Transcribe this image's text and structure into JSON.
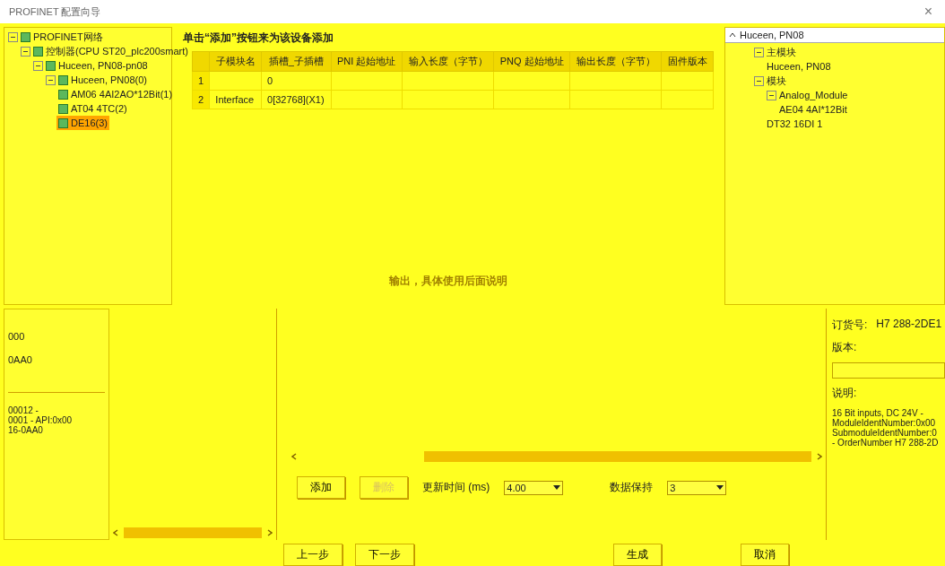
{
  "window": {
    "title": "PROFINET 配置向导",
    "close": "×"
  },
  "device_tree": [
    {
      "label": "PROFINET网络",
      "expanded": true,
      "children": [
        {
          "label": "控制器(CPU ST20_plc200smart)",
          "expanded": true,
          "children": [
            {
              "label": "Huceen, PN08-pn08",
              "expanded": true,
              "children": [
                {
                  "label": "Huceen, PN08(0)",
                  "expanded": true,
                  "children": [
                    {
                      "label": "AM06 4AI2AO*12Bit(1)",
                      "selected": false
                    },
                    {
                      "label": "AT04 4TC(2)",
                      "selected": false
                    },
                    {
                      "label": "DE16(3)",
                      "selected": true
                    }
                  ]
                }
              ]
            }
          ]
        }
      ]
    }
  ],
  "instruction": "单击“添加”按钮来为该设备添加",
  "table": {
    "columns": [
      "子模块名",
      "插槽_子插槽",
      "PNI 起始地址",
      "输入长度（字节）",
      "PNQ 起始地址",
      "输出长度（字节）",
      "固件版本"
    ],
    "rows": [
      {
        "number": "1",
        "slot": "0"
      },
      {
        "number": "2",
        "name": "Interface",
        "slot": "0[32768](X1)"
      }
    ]
  },
  "note": "输出，具体使用后面说明",
  "module_details": {
    "order": "000",
    "version": "0AA0",
    "description": [
      "00012 -",
      "0001 - API:0x00",
      "16-0AA0"
    ]
  },
  "actions": {
    "add": {
      "label": "添加",
      "disabled": false
    },
    "delete": {
      "label": "删除",
      "disabled": true
    }
  },
  "update_time": {
    "label": "更新时间 (ms)",
    "value": "4.00"
  },
  "data_hold": {
    "label": "数据保持",
    "value": "3"
  },
  "catalog": {
    "filter": "Huceen, PN08",
    "tree": [
      {
        "label": "主模块",
        "expanded": true,
        "children": [
          {
            "label": "Huceen, PN08"
          }
        ]
      },
      {
        "label": "模块",
        "expanded": true,
        "children": [
          {
            "label": "Analog_Module",
            "expanded": true,
            "children": [
              {
                "label": "AE04 4AI*12Bit"
              }
            ]
          },
          {
            "label": "DT32 16DI 1"
          }
        ]
      }
    ]
  },
  "info": {
    "order_label": "订货号:",
    "order_value": "H7 288-2DE1",
    "version_label": "版本:",
    "description_label": "说明:",
    "description": [
      "16 Bit inputs, DC 24V -",
      "ModuleIdentNumber:0x00",
      "SubmoduleIdentNumber:0",
      "- OrderNumber H7 288-2D"
    ]
  },
  "footer": {
    "back": "上一步",
    "next": "下一步",
    "generate": "生成",
    "cancel": "取消"
  }
}
